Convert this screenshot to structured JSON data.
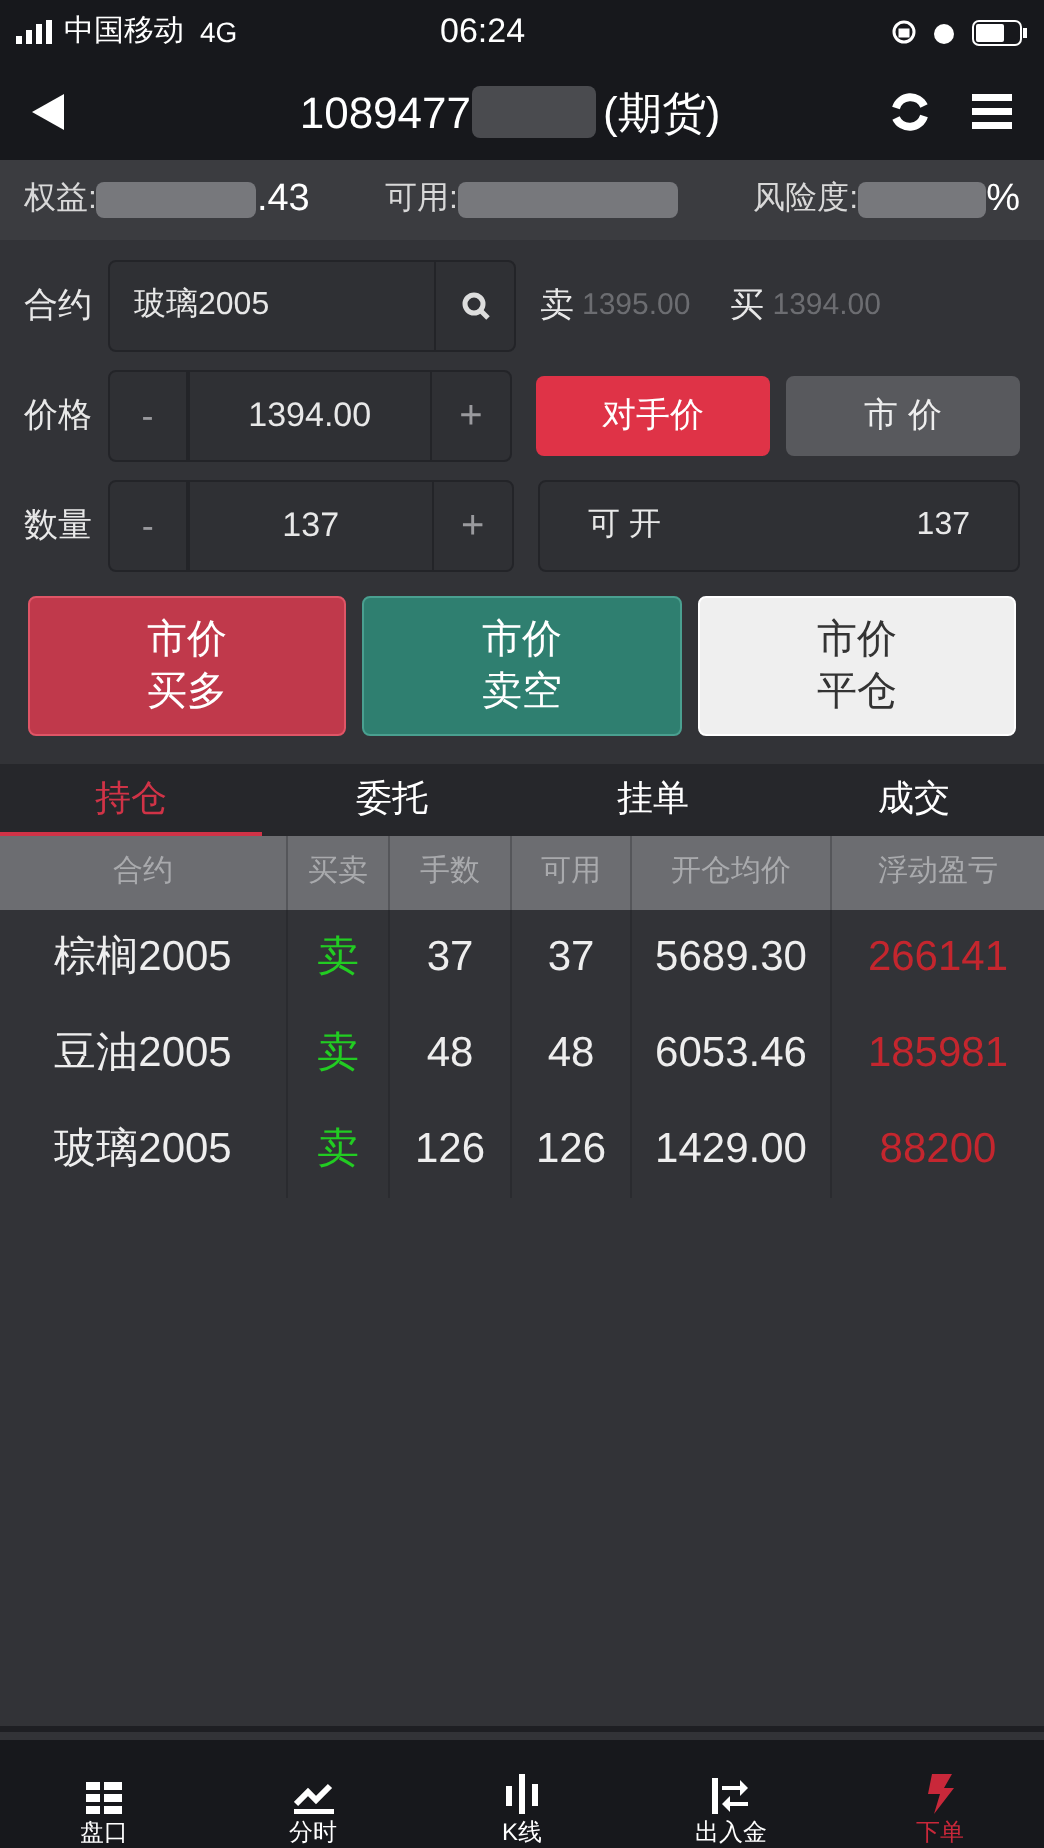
{
  "status_bar": {
    "carrier": "中国移动",
    "network": "4G",
    "time": "06:24"
  },
  "header": {
    "account": "1089477",
    "suffix": "(期货)"
  },
  "summary": [
    {
      "label": "权益:",
      "value": ".43"
    },
    {
      "label": "可用:"
    },
    {
      "label": "风险度:",
      "value": "%"
    }
  ],
  "contract": {
    "label": "合约",
    "value": "玻璃2005"
  },
  "quotes": [
    {
      "label": "卖",
      "price": "1395.00"
    },
    {
      "label": "买",
      "price": "1394.00"
    }
  ],
  "price": {
    "label": "价格",
    "minus": "-",
    "value": "1394.00",
    "plus": "+"
  },
  "price_modes": [
    {
      "label": "对手价",
      "selected": true
    },
    {
      "label": "市 价",
      "selected": false
    }
  ],
  "quantity": {
    "label": "数量",
    "minus": "-",
    "value": "137",
    "plus": "+"
  },
  "available": {
    "label": "可 开",
    "value": "137"
  },
  "actions": [
    {
      "kind": "buy",
      "line1": "市价",
      "line2": "买多"
    },
    {
      "kind": "sell",
      "line1": "市价",
      "line2": "卖空"
    },
    {
      "kind": "close",
      "line1": "市价",
      "line2": "平仓"
    }
  ],
  "tabs": [
    {
      "label": "持仓",
      "selected": true
    },
    {
      "label": "委托",
      "selected": false
    },
    {
      "label": "挂单",
      "selected": false
    },
    {
      "label": "成交",
      "selected": false
    }
  ],
  "table": {
    "columns": [
      "合约",
      "买卖",
      "手数",
      "可用",
      "开仓均价",
      "浮动盈亏"
    ],
    "rows": [
      {
        "contract": "棕榈2005",
        "side": "卖",
        "kind": "sell",
        "lots": "37",
        "available": "37",
        "avg_price": "5689.30",
        "pnl": "266141"
      },
      {
        "contract": "豆油2005",
        "side": "卖",
        "kind": "sell",
        "lots": "48",
        "available": "48",
        "avg_price": "6053.46",
        "pnl": "185981"
      },
      {
        "contract": "玻璃2005",
        "side": "卖",
        "kind": "sell",
        "lots": "126",
        "available": "126",
        "avg_price": "1429.00",
        "pnl": "88200"
      }
    ]
  },
  "bottom_nav": [
    {
      "label": "盘口",
      "selected": false
    },
    {
      "label": "分时",
      "selected": false
    },
    {
      "label": "K线",
      "selected": false
    },
    {
      "label": "出入金",
      "selected": false
    },
    {
      "label": "下单",
      "selected": true
    }
  ]
}
